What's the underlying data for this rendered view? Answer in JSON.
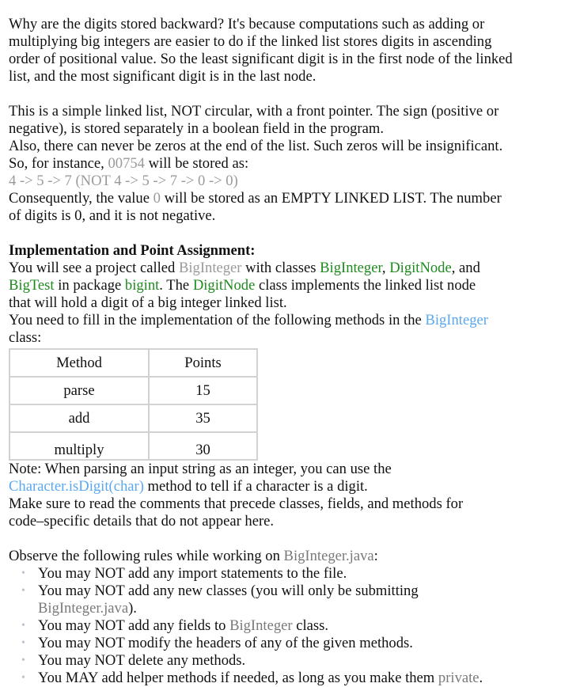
{
  "intro": {
    "paragraph": "Why are the digits stored backward? It's because computations such as adding or multiplying big integers are easier to do if the linked list stores digits in ascending order of positional value. So the least significant digit is in the first node of the linked list, and the most significant digit is in the last node."
  },
  "structure": {
    "line1": "This is a simple linked list, NOT circular, with a front pointer. The sign (positive or negative), is stored separately in a boolean field in the program.",
    "line2_pre": "Also, there can never be zeros at the end of the list. Such zeros will be insignificant. So, for instance, ",
    "line2_value": "00754",
    "line2_post": " will be stored as:",
    "example": "4 -> 5 -> 7 (NOT 4 -> 5 -> 7 -> 0 -> 0)",
    "line3_pre": "Consequently, the value ",
    "line3_value": "0",
    "line3_post": " will be stored as an EMPTY LINKED LIST. The number of digits is 0, and it is not negative."
  },
  "implementation": {
    "heading": "Implementation and Point Assignment:",
    "t1": "You will see a project called ",
    "project": "BigInteger",
    "t2": " with classes ",
    "class1": "BigInteger",
    "t3": ", ",
    "class2": "DigitNode",
    "t4": ", and ",
    "class3": "BigTest",
    "t5": " in package ",
    "package": "bigint",
    "t6": ". The ",
    "class4": "DigitNode",
    "t7": " class implements the linked list node that will hold a digit of a big integer linked list.",
    "t8": "You need to fill in the implementation of the following methods in the ",
    "class5": "BigInteger",
    "t9": " class:"
  },
  "table": {
    "headers": [
      "Method",
      "Points"
    ],
    "rows": [
      [
        "parse",
        "15"
      ],
      [
        "add",
        "35"
      ],
      [
        "multiply",
        "30"
      ]
    ]
  },
  "note": {
    "line1": "Note: When parsing an input string as an integer, you can use the ",
    "method": "Character.isDigit(char)",
    "line1b": " method to tell if a character is a digit.",
    "line2": "Make sure to read the comments that precede classes, fields, and methods for code–specific details that do not appear here."
  },
  "rules": {
    "intro_pre": "Observe the following rules while working on ",
    "intro_file": "BigInteger.java",
    "intro_post": ":",
    "bullet_glyph": "•",
    "items": [
      {
        "pre": "You may NOT add any import statements to the file.",
        "code": "",
        "post": ""
      },
      {
        "pre": "You may NOT add any new classes (you will only be submitting ",
        "code": "BigInteger.java",
        "post": ")."
      },
      {
        "pre": "You may NOT add any fields to ",
        "code": "BigInteger",
        "post": " class."
      },
      {
        "pre": "You may NOT modify the headers of any of the given methods.",
        "code": "",
        "post": ""
      },
      {
        "pre": "You may NOT delete any methods.",
        "code": "",
        "post": ""
      },
      {
        "pre": "You MAY add helper methods if needed, as long as you make them ",
        "code": "private",
        "post": "."
      }
    ]
  },
  "colors": {
    "text": "#111111",
    "code_gray": "#9a9a9a",
    "class_green": "#1f8a1f",
    "link_blue": "#5aa8f0",
    "table_border": "#d2d2d2"
  }
}
